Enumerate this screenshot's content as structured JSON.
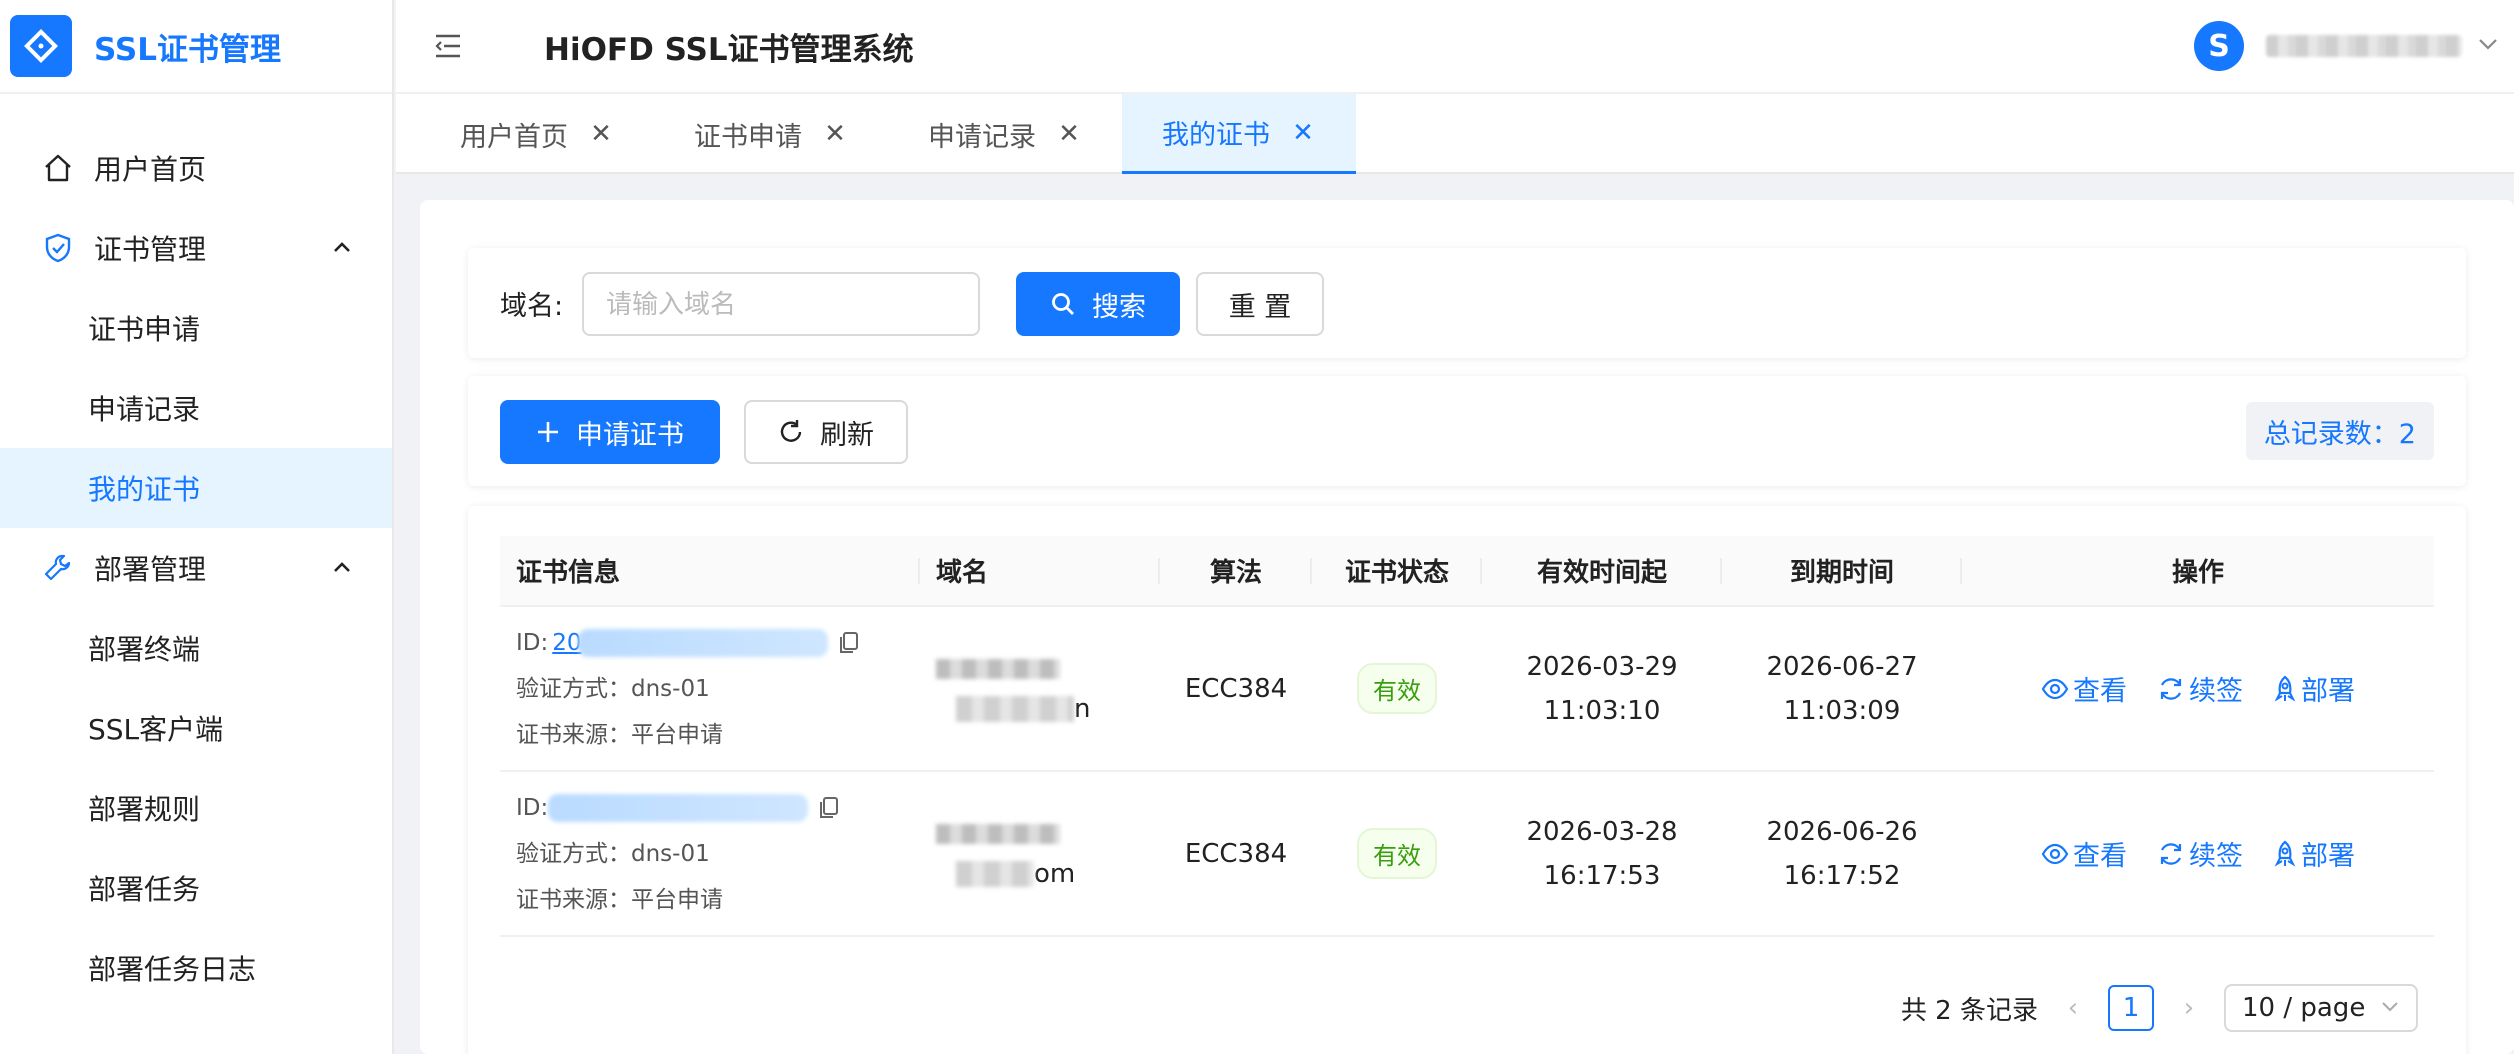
{
  "sidebar": {
    "logo_text": "SSL证书管理",
    "items": [
      {
        "label": "用户首页"
      },
      {
        "label": "证书管理"
      },
      {
        "label": "证书申请"
      },
      {
        "label": "申请记录"
      },
      {
        "label": "我的证书"
      },
      {
        "label": "部署管理"
      },
      {
        "label": "部署终端"
      },
      {
        "label": "SSL客户端"
      },
      {
        "label": "部署规则"
      },
      {
        "label": "部署任务"
      },
      {
        "label": "部署任务日志"
      }
    ]
  },
  "header": {
    "title": "HiOFD SSL证书管理系统",
    "avatar_letter": "S"
  },
  "tabs": [
    {
      "label": "用户首页"
    },
    {
      "label": "证书申请"
    },
    {
      "label": "申请记录"
    },
    {
      "label": "我的证书"
    }
  ],
  "search": {
    "label": "域名:",
    "placeholder": "请输入域名",
    "search_button": "搜索",
    "reset_button": "重 置"
  },
  "toolbar": {
    "apply_button": "申请证书",
    "refresh_button": "刷新",
    "total": "总记录数：2"
  },
  "table": {
    "columns": [
      "证书信息",
      "域名",
      "算法",
      "证书状态",
      "有效时间起",
      "到期时间",
      "操作"
    ],
    "rows": [
      {
        "id_prefix": "20",
        "verify": "验证方式：dns-01",
        "source": "证书来源：平台申请",
        "domain_suffix": "n",
        "algorithm": "ECC384",
        "status": "有效",
        "start_date": "2026-03-29",
        "start_time": "11:03:10",
        "end_date": "2026-06-27",
        "end_time": "11:03:09"
      },
      {
        "id_prefix": "",
        "verify": "验证方式：dns-01",
        "source": "证书来源：平台申请",
        "domain_suffix": "om",
        "algorithm": "ECC384",
        "status": "有效",
        "start_date": "2026-03-28",
        "start_time": "16:17:53",
        "end_date": "2026-06-26",
        "end_time": "16:17:52"
      }
    ],
    "actions": {
      "view": "查看",
      "renew": "续签",
      "deploy": "部署"
    }
  },
  "pagination": {
    "total_text": "共 2 条记录",
    "current_page": "1",
    "page_size": "10 / page"
  },
  "colors": {
    "primary": "#1677ff",
    "success": "#389e0d"
  }
}
